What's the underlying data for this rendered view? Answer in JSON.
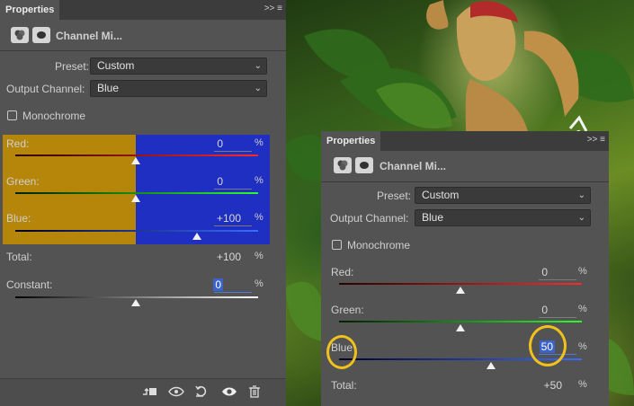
{
  "left_panel": {
    "tab": "Properties",
    "tab_menu": ">>  ≡",
    "header_title": "Channel Mi...",
    "preset_label": "Preset:",
    "preset_value": "Custom",
    "output_label": "Output Channel:",
    "output_value": "Blue",
    "monochrome_label": "Monochrome",
    "red_label": "Red:",
    "red_value": "0",
    "green_label": "Green:",
    "green_value": "0",
    "blue_label": "Blue:",
    "blue_value": "+100",
    "total_label": "Total:",
    "total_value": "+100",
    "constant_label": "Constant:",
    "constant_value": "0",
    "pct": "%"
  },
  "right_panel": {
    "tab": "Properties",
    "tab_menu": ">>  ≡",
    "header_title": "Channel Mi...",
    "preset_label": "Preset:",
    "preset_value": "Custom",
    "output_label": "Output Channel:",
    "output_value": "Blue",
    "monochrome_label": "Monochrome",
    "red_label": "Red:",
    "red_value": "0",
    "green_label": "Green:",
    "green_value": "0",
    "blue_label": "Blue",
    "blue_value": "50",
    "total_label": "Total:",
    "total_value": "+50",
    "pct": "%"
  },
  "footer_icons": [
    "clip-to-layer-icon",
    "visibility-previous-icon",
    "reset-icon",
    "eye-icon",
    "trash-icon"
  ],
  "colors": {
    "panel": "#535353",
    "highlight_orange": "#b5860a",
    "highlight_blue": "#1f2fc2",
    "annotation": "#f1c21b"
  }
}
